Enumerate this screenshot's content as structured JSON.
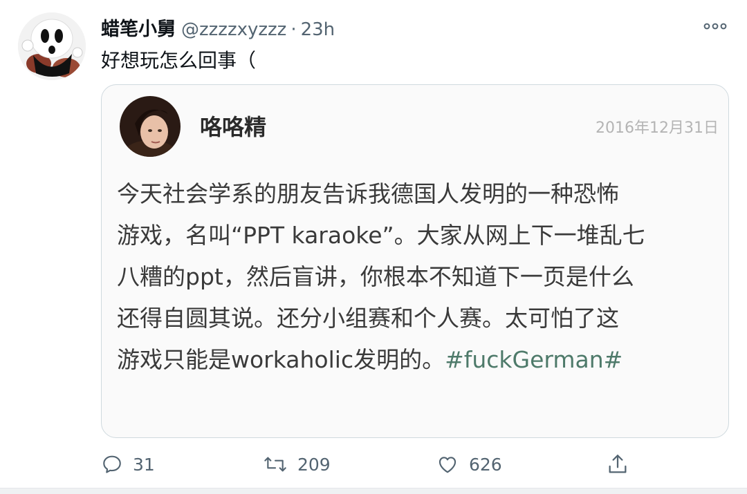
{
  "tweet": {
    "display_name": "蜡笔小舅",
    "handle": "@zzzzxyzzz",
    "separator": "·",
    "time": "23h",
    "text": "好想玩怎么回事（"
  },
  "quote": {
    "name": "咯咯精",
    "date": "2016年12月31日",
    "lines": [
      "今天社会学系的朋友告诉我德国人发明的一种恐怖",
      "游戏，名叫“PPT karaoke”。大家从网上下一堆乱七",
      "八糟的ppt，然后盲讲，你根本不知道下一页是什么",
      "还得自圆其说。还分小组赛和个人赛。太可怕了这"
    ],
    "last_line_text": "游戏只能是workaholic发明的。",
    "hashtag": "#fuckGerman#"
  },
  "actions": {
    "reply_count": "31",
    "retweet_count": "209",
    "like_count": "626"
  },
  "icons": {
    "reply": "reply-icon",
    "retweet": "retweet-icon",
    "like": "heart-icon",
    "share": "share-icon",
    "more": "more-icon"
  }
}
